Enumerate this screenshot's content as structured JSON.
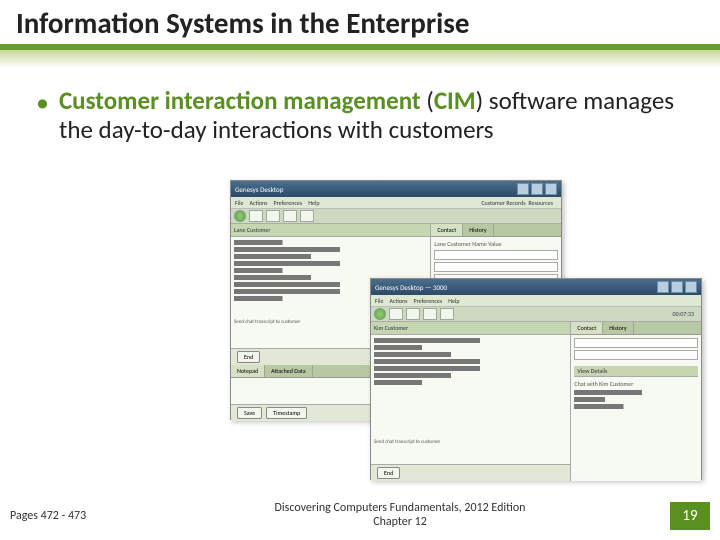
{
  "title": "Information Systems in the Enterprise",
  "bullet": {
    "dot": "•",
    "term": "Customer interaction management",
    "acronym_open": "(",
    "acronym": "CIM",
    "acronym_close": ")",
    "rest": " software manages the day-to-day interactions with customers"
  },
  "screenshots": {
    "win1": {
      "title": "Genesys Desktop",
      "menu": [
        "File",
        "Actions",
        "Preferences",
        "Help"
      ],
      "left_panel": "Lane Customer",
      "tabs_right_a": "Contact",
      "tabs_right_b": "History",
      "btn_end": "End",
      "btn_save": "Save",
      "btn_time": "Timestamp",
      "send_label": "Send chat transcript to customer",
      "record_tabs_a": "Customer Records",
      "record_tabs_b": "Resources",
      "field_label": "Lane Customer Name Value"
    },
    "win2": {
      "title": "Genesys Desktop — 3000",
      "menu": [
        "File",
        "Actions",
        "Preferences",
        "Help"
      ],
      "left_panel": "Kim Customer",
      "timer": "00:07:33",
      "btn_end": "End",
      "send_label": "Send chat transcript to customer",
      "tabs_right_a": "Contact",
      "tabs_right_b": "History",
      "view_label": "View Details",
      "chat_label": "Chat with Kim Customer"
    }
  },
  "footer": {
    "pages": "Pages 472 - 473",
    "book": "Discovering Computers Fundamentals, 2012 Edition",
    "chapter": "Chapter 12",
    "slide_num": "19"
  }
}
